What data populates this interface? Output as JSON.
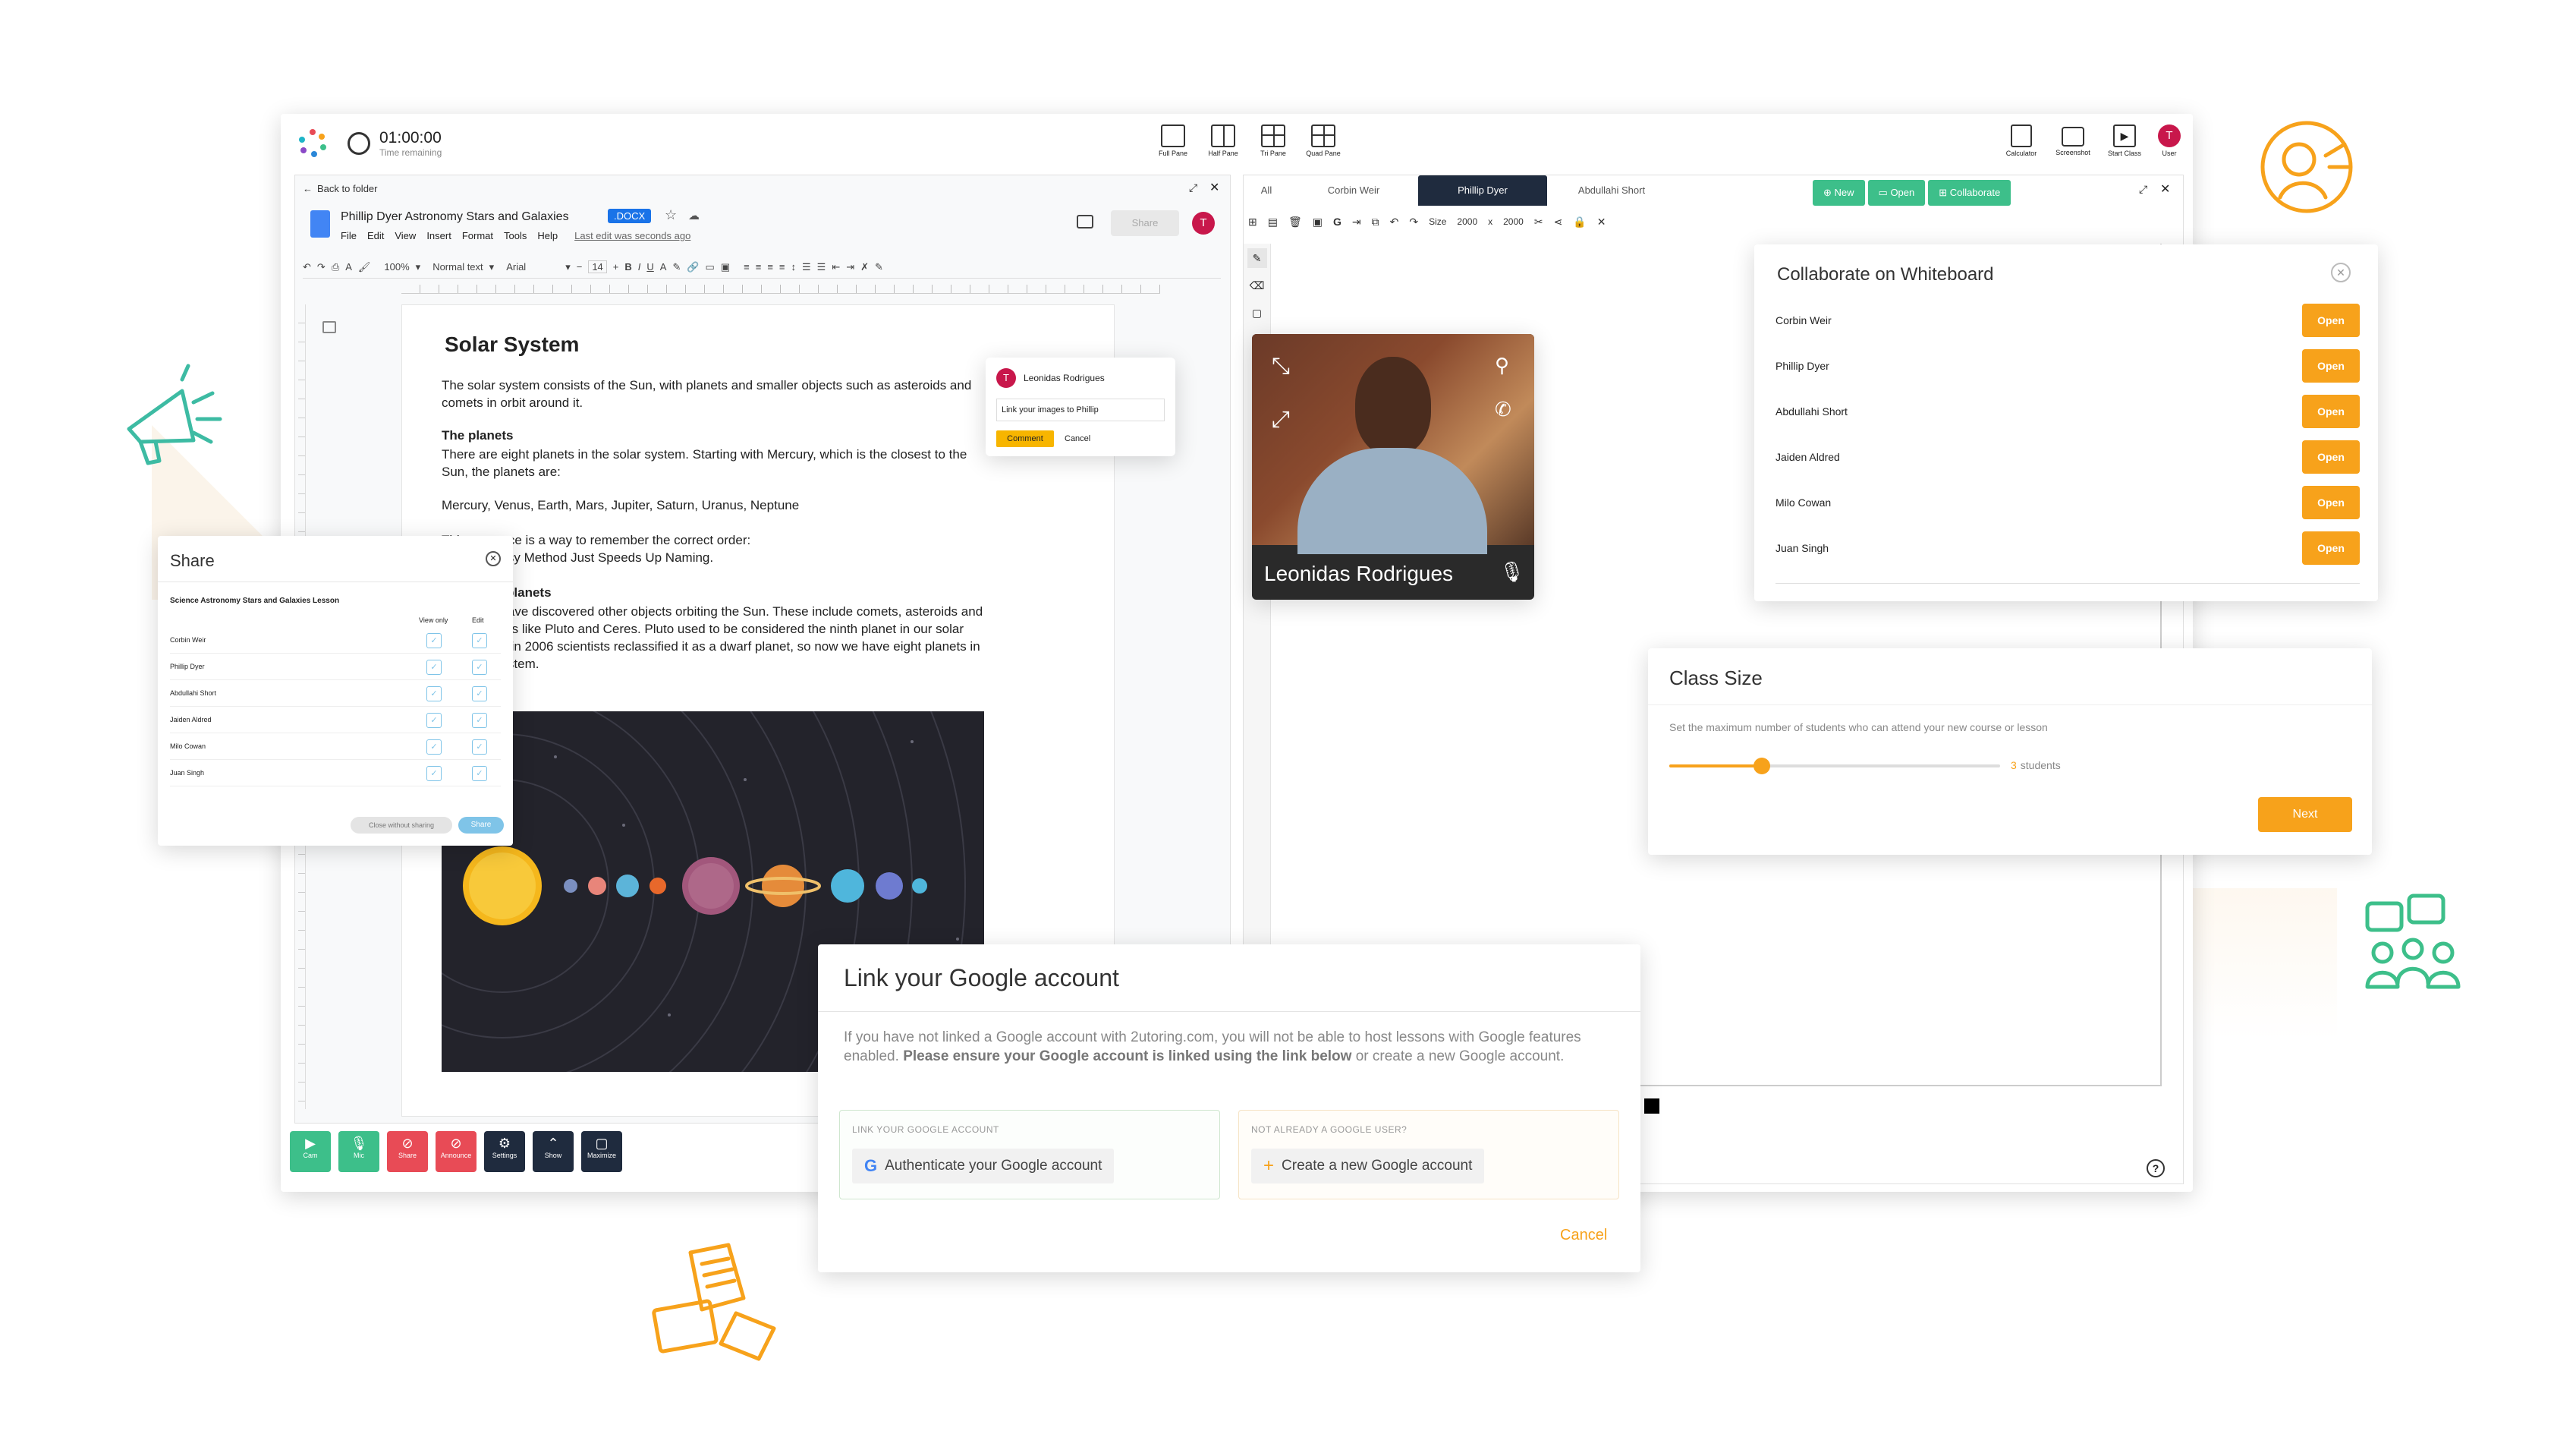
{
  "colors": {
    "accent": "#f7a21b",
    "green": "#3dbf8a",
    "teal": "#1f9e6e",
    "red": "#e84b56",
    "navy": "#1f2b3e",
    "brand_red": "#c8174b"
  },
  "topbar": {
    "timer": "01:00:00",
    "timer_sub": "Time remaining",
    "panes": [
      {
        "label": "Full Pane"
      },
      {
        "label": "Half Pane"
      },
      {
        "label": "Tri Pane"
      },
      {
        "label": "Quad Pane"
      }
    ],
    "tools": [
      {
        "label": "Calculator",
        "icon": "calculator-icon"
      },
      {
        "label": "Screenshot",
        "icon": "camera-icon"
      },
      {
        "label": "Start Class",
        "icon": "play-icon"
      },
      {
        "label": "User",
        "icon": "user-icon"
      }
    ],
    "avatar": "T"
  },
  "doc": {
    "back": "Back to folder",
    "title": "Phillip Dyer Astronomy Stars and Galaxies",
    "badge": ".DOCX",
    "menu": [
      "File",
      "Edit",
      "View",
      "Insert",
      "Format",
      "Tools",
      "Help"
    ],
    "last_edit": "Last edit was seconds ago",
    "share_btn": "Share",
    "avatar": "T",
    "zoom": "100%",
    "style": "Normal text",
    "font": "Arial",
    "font_size": "14",
    "heading": "Solar System",
    "p1": "The solar system consists of the Sun, with planets and smaller objects such as asteroids and comets in orbit around it.",
    "h_planets": "The planets",
    "p2": "There are eight planets in the solar system. Starting with Mercury, which is the closest to the Sun, the planets are:",
    "p3": "Mercury, Venus, Earth, Mars, Jupiter, Saturn, Uranus, Neptune",
    "p4a": "This sentence is a way to remember the correct order:",
    "p4b": "My Very Easy Method Just Speeds Up Naming.",
    "h_dwarf": "The dwarf planets",
    "p5": "Scientists have discovered other objects orbiting the Sun. These include comets, asteroids and dwarf planets like Pluto and Ceres. Pluto used to be considered the ninth planet in our solar system, but in 2006 scientists reclassified it as a dwarf planet, so now we have eight planets in the solar system."
  },
  "comment": {
    "avatar": "T",
    "name": "Leonidas Rodrigues",
    "text": "Link your images to Phillip",
    "comment_btn": "Comment",
    "cancel_btn": "Cancel"
  },
  "share": {
    "title": "Share",
    "subtitle": "Science Astronomy Stars and Galaxies Lesson",
    "col_view": "View only",
    "col_edit": "Edit",
    "students": [
      "Corbin Weir",
      "Phillip Dyer",
      "Abdullahi Short",
      "Jaiden Aldred",
      "Milo Cowan",
      "Juan Singh"
    ],
    "close_btn": "Close without sharing",
    "share_btn": "Share"
  },
  "bottom_bar": [
    {
      "label": "Cam",
      "icon": "camera-icon"
    },
    {
      "label": "Mic",
      "icon": "mic-icon"
    },
    {
      "label": "Share",
      "icon": "share-off-icon"
    },
    {
      "label": "Announce",
      "icon": "announce-off-icon"
    },
    {
      "label": "Settings",
      "icon": "gear-icon"
    },
    {
      "label": "Show",
      "icon": "chevron-up-icon"
    },
    {
      "label": "Maximize",
      "icon": "maximize-icon"
    }
  ],
  "wb": {
    "tabs": [
      "All",
      "Corbin Weir",
      "Phillip Dyer",
      "Abdullahi Short"
    ],
    "active_tab": "Phillip Dyer",
    "btn_new": "New",
    "btn_open": "Open",
    "btn_collab": "Collaborate",
    "size_label": "Size",
    "w": "2000",
    "x": "x",
    "h": "2000"
  },
  "video": {
    "name": "Leonidas Rodrigues"
  },
  "collab": {
    "title": "Collaborate on Whiteboard",
    "open_label": "Open",
    "students": [
      "Corbin Weir",
      "Phillip Dyer",
      "Abdullahi Short",
      "Jaiden Aldred",
      "Milo Cowan",
      "Juan Singh"
    ]
  },
  "class_size": {
    "title": "Class Size",
    "desc": "Set the maximum number of students who can attend your new course or lesson",
    "value_num": "3",
    "value_unit": "students",
    "slider_fraction": 0.28,
    "next": "Next"
  },
  "google": {
    "title": "Link your Google account",
    "text_a": "If you have not linked a Google account with 2utoring.com, you will not be able to host lessons with Google features enabled. ",
    "text_b": "Please ensure your Google account is linked using the link below",
    "text_c": " or create a new Google account.",
    "left_head": "LINK YOUR GOOGLE ACCOUNT",
    "left_btn": "Authenticate your Google account",
    "right_head": "NOT ALREADY A GOOGLE USER?",
    "right_btn": "Create a new Google account",
    "cancel": "Cancel"
  }
}
